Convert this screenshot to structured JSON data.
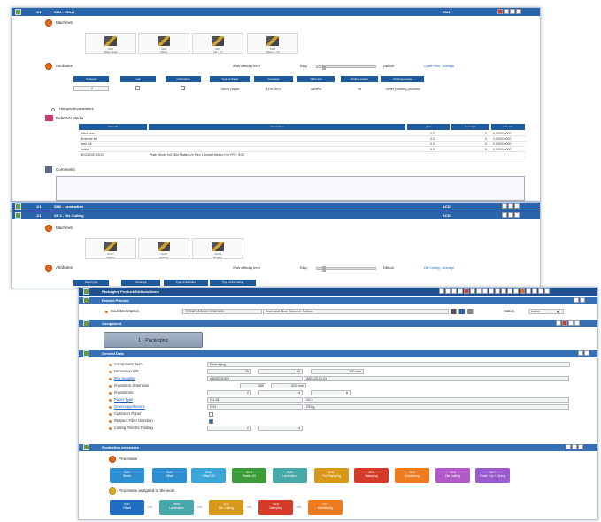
{
  "panel1": {
    "title": "SM4 - Offset",
    "right_label": "SM4",
    "id": "1/1",
    "machines_title": "Machines",
    "machines": [
      {
        "code": "SM1",
        "name": "Offset sheet"
      },
      {
        "code": "SM2",
        "name": "Offset"
      },
      {
        "code": "SM3",
        "name": "SM - 74"
      },
      {
        "code": "SM4",
        "name": "Offset + UV"
      }
    ],
    "attributes_title": "Attributes",
    "work_difficulty_label": "Work difficulty level",
    "easy_label": "Easy",
    "difficult_label": "Difficult",
    "link": "Offset Print - Average",
    "table_headers": [
      "Contours",
      "Lak",
      "Cold stamp",
      "Type of Paper",
      "Coverage",
      "Other info",
      "Printing Colors",
      "Printing process"
    ],
    "table_values": [
      "2",
      "",
      "",
      "Other paper",
      "11%-30%",
      "Others",
      "+6",
      "Other printing process"
    ],
    "more_params": "Has specific parameters",
    "relevant_media_title": "Relevant Media",
    "media_headers": [
      "Material",
      "Description",
      "grm²",
      "Coverage",
      "Info-max"
    ],
    "media_rows": [
      {
        "material": "Intfor blue",
        "desc": "",
        "grm": "0.0",
        "cov": "0",
        "info": "0,000/0,0000"
      },
      {
        "material": "Bivierme foil",
        "desc": "",
        "grm": "0.0",
        "cov": "0",
        "info": "0,000/0,0000"
      },
      {
        "material": "Iram foil",
        "desc": "",
        "grm": "0.0",
        "cov": "0",
        "info": "0,000/0,0000"
      },
      {
        "material": "Yellow",
        "desc": "",
        "grm": "0.0",
        "cov": "0",
        "info": "0,000/0,0000"
      },
      {
        "material": "BKC0225783100",
        "desc": "Plate: Sheet foil SM4 Plastic UV Plex 1 Jinbatt Mesho Fan FR + 3/35",
        "grm": "",
        "cov": "",
        "info": ""
      }
    ],
    "comments_title": "Comments"
  },
  "panel2": {
    "rows": [
      {
        "id": "1/1",
        "title": "SM6 - Lamination",
        "right_label": "AC07"
      },
      {
        "id": "1/1",
        "title": "SE 6 - Die Cutting",
        "right_label": "AC04"
      }
    ],
    "machines_title": "Machines",
    "machines": [
      {
        "code": "AC07",
        "name": "Agrarre"
      },
      {
        "code": "AC08",
        "name": "Alliance"
      },
      {
        "code": "AC04",
        "name": "Bogard"
      }
    ],
    "attributes_title": "Attributes",
    "work_difficulty_label": "Work difficulty level",
    "easy_label": "Easy",
    "difficult_label": "Difficult",
    "link": "Die Cutting - Average",
    "buttons": [
      "Paper type",
      "Coverage",
      "Type of die holes",
      "Type of die cutting"
    ]
  },
  "panel3": {
    "title": "Packaging Product/Editions/Items",
    "related_product": "Related Product",
    "code_desc_label": "Code/Description",
    "code_value": "TRSUFLE3001Y0N00153",
    "desc_value": "Bivierable Box: Summer Edition",
    "status_label": "Status",
    "status_value": "Active",
    "component_section": "Component",
    "component_button": "1 - Packaging",
    "general_section": "General Data",
    "fields": [
      {
        "label": "Component desc.",
        "link": false,
        "v1": "Packaging",
        "v2": "",
        "v3": ""
      },
      {
        "label": "Dimension W/L",
        "link": false,
        "v1": "75",
        "v2": "60",
        "v3": "150 mm"
      },
      {
        "label": "Box Supplier",
        "link": true,
        "v1": "ABGEM1901",
        "v2": "ABS.20.01.01",
        "v3": ""
      },
      {
        "label": "Imposition dimension",
        "link": false,
        "v1": "380",
        "v2": "632 mm",
        "v3": ""
      },
      {
        "label": "Impositions",
        "link": false,
        "v1": "2",
        "v2": "4",
        "v3": "8"
      },
      {
        "label": "Paper Type",
        "link": true,
        "v1": "G1.18",
        "v2": "GC1",
        "v3": ""
      },
      {
        "label": "Grammage/Bicons",
        "link": true,
        "v1": "G34",
        "v2": "230 g",
        "v3": ""
      },
      {
        "label": "Customer Paper",
        "link": false,
        "v1": "",
        "v2": "",
        "v3": ""
      },
      {
        "label": "Respect Fiber Direction",
        "link": false,
        "v1": "",
        "v2": "",
        "v3": ""
      },
      {
        "label": "Cutting Plan for Folding",
        "link": false,
        "v1": "2",
        "v2": "4",
        "v3": ""
      }
    ],
    "production_section": "Production processes",
    "processes_title": "Processes",
    "processes": [
      {
        "code": "SM1",
        "name": "Sheet",
        "color": "#2d8fd0"
      },
      {
        "code": "SM2",
        "name": "Offset",
        "color": "#2d8fd0"
      },
      {
        "code": "SM3",
        "name": "Offset UV",
        "color": "#3aa7d8"
      },
      {
        "code": "SM4",
        "name": "Plastic UV",
        "color": "#3e9b3a"
      },
      {
        "code": "SM5",
        "name": "Lamination",
        "color": "#47a8a8"
      },
      {
        "code": "SM6",
        "name": "Foil Stamping",
        "color": "#d69a18"
      },
      {
        "code": "SE6",
        "name": "Stamping",
        "color": "#d63b2a"
      },
      {
        "code": "SE6",
        "name": "Addabbung",
        "color": "#f07a1e"
      },
      {
        "code": "SE8",
        "name": "Die Cutting",
        "color": "#b25bc8"
      },
      {
        "code": "SE7",
        "name": "Finish Cut + Gluing",
        "color": "#9a5ad0"
      }
    ],
    "assigned_title": "Processes assigned to the work",
    "assigned": [
      {
        "code": "SM2",
        "name": "Offset",
        "color": "#1f6cc0"
      },
      {
        "code": "SM5",
        "name": "Lamination",
        "color": "#47a8a8"
      },
      {
        "code": "SE6",
        "name": "Die Cutting",
        "color": "#d69a18"
      },
      {
        "code": "SE8",
        "name": "Stamping",
        "color": "#d63b2a"
      },
      {
        "code": "SE7",
        "name": "Addabbung",
        "color": "#f07a1e"
      }
    ]
  }
}
